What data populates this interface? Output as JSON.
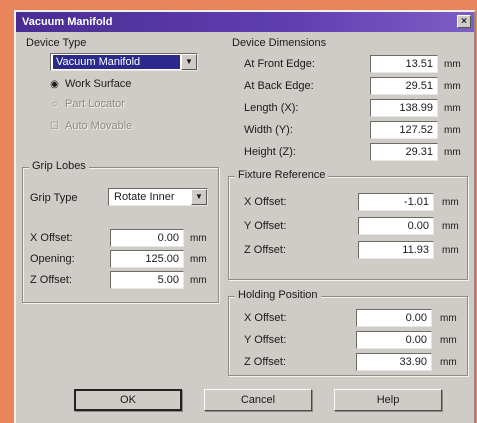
{
  "window": {
    "title": "Vacuum Manifold",
    "close_glyph": "×"
  },
  "device_type": {
    "title": "Device Type",
    "selected": "Vacuum Manifold",
    "options": [
      {
        "label": "Work Surface",
        "selected": true,
        "disabled": false
      },
      {
        "label": "Part Locator",
        "selected": false,
        "disabled": true
      }
    ],
    "checkbox": {
      "label": "Auto Movable",
      "checked": false,
      "disabled": true
    }
  },
  "grip_lobes": {
    "title": "Grip Lobes",
    "type_label": "Grip Type",
    "type_value": "Rotate Inner",
    "rows": [
      {
        "label": "X Offset:",
        "value": "0.00",
        "unit": "mm"
      },
      {
        "label": "Opening:",
        "value": "125.00",
        "unit": "mm"
      },
      {
        "label": "Z Offset:",
        "value": "5.00",
        "unit": "mm"
      }
    ]
  },
  "device_dimensions": {
    "title": "Device Dimensions",
    "rows": [
      {
        "label": "At Front Edge:",
        "value": "13.51",
        "unit": "mm"
      },
      {
        "label": "At Back Edge:",
        "value": "29.51",
        "unit": "mm"
      },
      {
        "label": "Length (X):",
        "value": "138.99",
        "unit": "mm"
      },
      {
        "label": "Width (Y):",
        "value": "127.52",
        "unit": "mm"
      },
      {
        "label": "Height (Z):",
        "value": "29.31",
        "unit": "mm"
      }
    ]
  },
  "reference": {
    "title": "Fixture Reference",
    "rows": [
      {
        "label": "X Offset:",
        "value": "-1.01",
        "unit": "mm"
      },
      {
        "label": "Y Offset:",
        "value": "0.00",
        "unit": "mm"
      },
      {
        "label": "Z Offset:",
        "value": "11.93",
        "unit": "mm"
      }
    ]
  },
  "holding_position": {
    "title": "Holding Position",
    "rows": [
      {
        "label": "X Offset:",
        "value": "0.00",
        "unit": "mm"
      },
      {
        "label": "Y Offset:",
        "value": "0.00",
        "unit": "mm"
      },
      {
        "label": "Z Offset:",
        "value": "33.90",
        "unit": "mm"
      }
    ]
  },
  "buttons": {
    "ok": "OK",
    "cancel": "Cancel",
    "help": "Help"
  }
}
